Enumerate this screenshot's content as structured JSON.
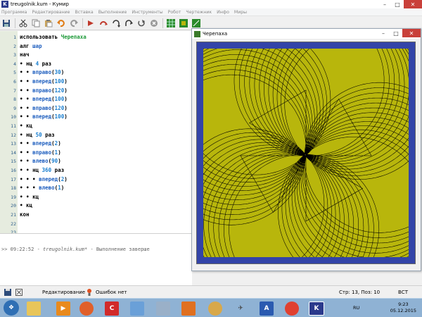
{
  "window": {
    "title": "treugolnik.kum - Кумир",
    "app_letter": "K"
  },
  "menu": [
    "Программа",
    "Редактирование",
    "Вставка",
    "Выполнение",
    "Инструменты",
    "Робот",
    "Чертежник",
    "Инфо",
    "Миры"
  ],
  "toolbar": {
    "buttons": [
      "save-icon",
      "cut-icon",
      "copy-icon",
      "paste-icon",
      "undo-icon",
      "redo-icon",
      "run-icon",
      "step-icon",
      "step-in-icon",
      "step-out-icon",
      "run-to-end-icon",
      "stop-icon",
      "robot-window-icon",
      "turtle-window-icon",
      "draw-window-icon"
    ]
  },
  "editor": {
    "line_numbers": [
      "1",
      "2",
      "3",
      "4",
      "5",
      "6",
      "7",
      "8",
      "9",
      "10",
      "11",
      "12",
      "13",
      "14",
      "15",
      "16",
      "17",
      "18",
      "19",
      "20",
      "21",
      "22",
      "23"
    ],
    "lines": [
      [
        {
          "t": "использовать ",
          "c": "kw"
        },
        {
          "t": "Черепаха",
          "c": "name"
        }
      ],
      [
        {
          "t": "алг ",
          "c": "kw"
        },
        {
          "t": "шар",
          "c": "fn"
        }
      ],
      [
        {
          "t": "нач",
          "c": "kw"
        }
      ],
      [
        {
          "t": "• ",
          "c": "dot"
        },
        {
          "t": "нц ",
          "c": "kw"
        },
        {
          "t": "4",
          "c": "num"
        },
        {
          "t": " раз",
          "c": "kw"
        }
      ],
      [
        {
          "t": "• • ",
          "c": "dot"
        },
        {
          "t": "вправо",
          "c": "fn"
        },
        {
          "t": "(",
          "c": "kw"
        },
        {
          "t": "30",
          "c": "num"
        },
        {
          "t": ")",
          "c": "kw"
        }
      ],
      [
        {
          "t": "• • ",
          "c": "dot"
        },
        {
          "t": "вперед",
          "c": "fn"
        },
        {
          "t": "(",
          "c": "kw"
        },
        {
          "t": "100",
          "c": "num"
        },
        {
          "t": ")",
          "c": "kw"
        }
      ],
      [
        {
          "t": "• • ",
          "c": "dot"
        },
        {
          "t": "вправо",
          "c": "fn"
        },
        {
          "t": "(",
          "c": "kw"
        },
        {
          "t": "120",
          "c": "num"
        },
        {
          "t": ")",
          "c": "kw"
        }
      ],
      [
        {
          "t": "• • ",
          "c": "dot"
        },
        {
          "t": "вперед",
          "c": "fn"
        },
        {
          "t": "(",
          "c": "kw"
        },
        {
          "t": "100",
          "c": "num"
        },
        {
          "t": ")",
          "c": "kw"
        }
      ],
      [
        {
          "t": "• • ",
          "c": "dot"
        },
        {
          "t": "вправо",
          "c": "fn"
        },
        {
          "t": "(",
          "c": "kw"
        },
        {
          "t": "120",
          "c": "num"
        },
        {
          "t": ")",
          "c": "kw"
        }
      ],
      [
        {
          "t": "• • ",
          "c": "dot"
        },
        {
          "t": "вперед",
          "c": "fn"
        },
        {
          "t": "(",
          "c": "kw"
        },
        {
          "t": "100",
          "c": "num"
        },
        {
          "t": ")",
          "c": "kw"
        }
      ],
      [
        {
          "t": "• ",
          "c": "dot"
        },
        {
          "t": "кц",
          "c": "kw"
        }
      ],
      [
        {
          "t": "• ",
          "c": "dot"
        },
        {
          "t": "нц ",
          "c": "kw"
        },
        {
          "t": "50",
          "c": "num"
        },
        {
          "t": " раз",
          "c": "kw"
        }
      ],
      [
        {
          "t": "• • ",
          "c": "dot"
        },
        {
          "t": "вперед",
          "c": "fn"
        },
        {
          "t": "(",
          "c": "kw"
        },
        {
          "t": "2",
          "c": "num"
        },
        {
          "t": ")",
          "c": "kw"
        }
      ],
      [
        {
          "t": "• • ",
          "c": "dot"
        },
        {
          "t": "вправо",
          "c": "fn"
        },
        {
          "t": "(",
          "c": "kw"
        },
        {
          "t": "1",
          "c": "num"
        },
        {
          "t": ")",
          "c": "kw"
        }
      ],
      [
        {
          "t": "• • ",
          "c": "dot"
        },
        {
          "t": "влево",
          "c": "fn"
        },
        {
          "t": "(",
          "c": "kw"
        },
        {
          "t": "90",
          "c": "num"
        },
        {
          "t": ")",
          "c": "kw"
        }
      ],
      [
        {
          "t": "• • ",
          "c": "dot"
        },
        {
          "t": "нц ",
          "c": "kw"
        },
        {
          "t": "360",
          "c": "num"
        },
        {
          "t": " раз",
          "c": "kw"
        }
      ],
      [
        {
          "t": "• • • ",
          "c": "dot"
        },
        {
          "t": "вперед",
          "c": "fn"
        },
        {
          "t": "(",
          "c": "kw"
        },
        {
          "t": "2",
          "c": "num"
        },
        {
          "t": ")",
          "c": "kw"
        }
      ],
      [
        {
          "t": "• • • ",
          "c": "dot"
        },
        {
          "t": "влево",
          "c": "fn"
        },
        {
          "t": "(",
          "c": "kw"
        },
        {
          "t": "1",
          "c": "num"
        },
        {
          "t": ")",
          "c": "kw"
        }
      ],
      [
        {
          "t": "• • ",
          "c": "dot"
        },
        {
          "t": "кц",
          "c": "kw"
        }
      ],
      [
        {
          "t": "• ",
          "c": "dot"
        },
        {
          "t": "кц",
          "c": "kw"
        }
      ],
      [
        {
          "t": "кон",
          "c": "kw"
        }
      ],
      [],
      []
    ]
  },
  "messages": [
    {
      "time": ">> 09:22:52 - ",
      "file": "treugolnik.kum*",
      "text": " - Выполнение заверше"
    }
  ],
  "turtle": {
    "title": "Черепаха",
    "colors": {
      "border": "#3344a8",
      "field": "#b8b60c",
      "pen": "#000000"
    }
  },
  "status": {
    "mode": "Редактирование",
    "errors": "Ошибок нет",
    "position": "Стр: 13, Поз: 10",
    "insert": "ВСТ"
  },
  "taskbar": {
    "lang": "RU",
    "time": "9:23",
    "date": "05.12.2015"
  }
}
